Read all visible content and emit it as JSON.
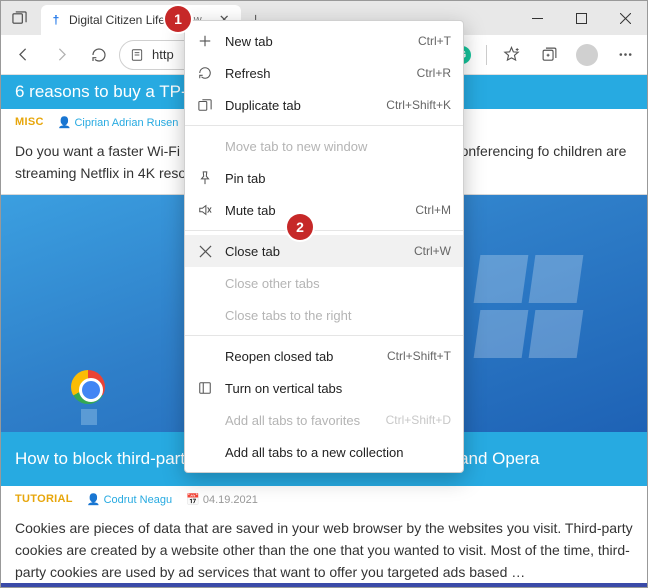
{
  "tab": {
    "title": "Digital Citizen Life in a",
    "favicon_label": "†"
  },
  "addressbar": {
    "url_text": "http"
  },
  "window_controls": {
    "minimize": "—",
    "maximize": "▢",
    "close": "✕"
  },
  "context_menu": [
    {
      "icon": "plus",
      "label": "New tab",
      "shortcut": "Ctrl+T",
      "enabled": true
    },
    {
      "icon": "refresh",
      "label": "Refresh",
      "shortcut": "Ctrl+R",
      "enabled": true
    },
    {
      "icon": "duplicate",
      "label": "Duplicate tab",
      "shortcut": "Ctrl+Shift+K",
      "enabled": true
    },
    {
      "sep": true
    },
    {
      "icon": "",
      "label": "Move tab to new window",
      "shortcut": "",
      "enabled": false
    },
    {
      "icon": "pin",
      "label": "Pin tab",
      "shortcut": "",
      "enabled": true
    },
    {
      "icon": "mute",
      "label": "Mute tab",
      "shortcut": "Ctrl+M",
      "enabled": true
    },
    {
      "sep": true
    },
    {
      "icon": "close",
      "label": "Close tab",
      "shortcut": "Ctrl+W",
      "enabled": true,
      "highlight": true
    },
    {
      "icon": "",
      "label": "Close other tabs",
      "shortcut": "",
      "enabled": false
    },
    {
      "icon": "",
      "label": "Close tabs to the right",
      "shortcut": "",
      "enabled": false
    },
    {
      "sep": true
    },
    {
      "icon": "",
      "label": "Reopen closed tab",
      "shortcut": "Ctrl+Shift+T",
      "enabled": true
    },
    {
      "icon": "vertical",
      "label": "Turn on vertical tabs",
      "shortcut": "",
      "enabled": true
    },
    {
      "icon": "",
      "label": "Add all tabs to favorites",
      "shortcut": "Ctrl+Shift+D",
      "enabled": false
    },
    {
      "icon": "",
      "label": "Add all tabs to a new collection",
      "shortcut": "",
      "enabled": true
    }
  ],
  "article1": {
    "title": "6 reasons to buy a TP-Li",
    "category": "MISC",
    "author": "Ciprian Adrian Rusen",
    "body": "Do you want a faster Wi-Fi ho                                                                    traffic? Do you want to do Full HD video conferencing fo                                                                       children are streaming Netflix in 4K resolutions or playing g                                                               …"
  },
  "article2": {
    "title": "How to block third-party cookies in Chrome, Firefox, Edge, and Opera",
    "category": "TUTORIAL",
    "author": "Codrut Neagu",
    "date": "04.19.2021",
    "body": "Cookies are pieces of data that are saved in your web browser by the websites you visit. Third-party cookies are created by a website other than the one that you wanted to visit. Most of the time, third-party cookies are used by ad services that want to offer you targeted ads based …"
  },
  "callouts": {
    "c1": "1",
    "c2": "2"
  }
}
